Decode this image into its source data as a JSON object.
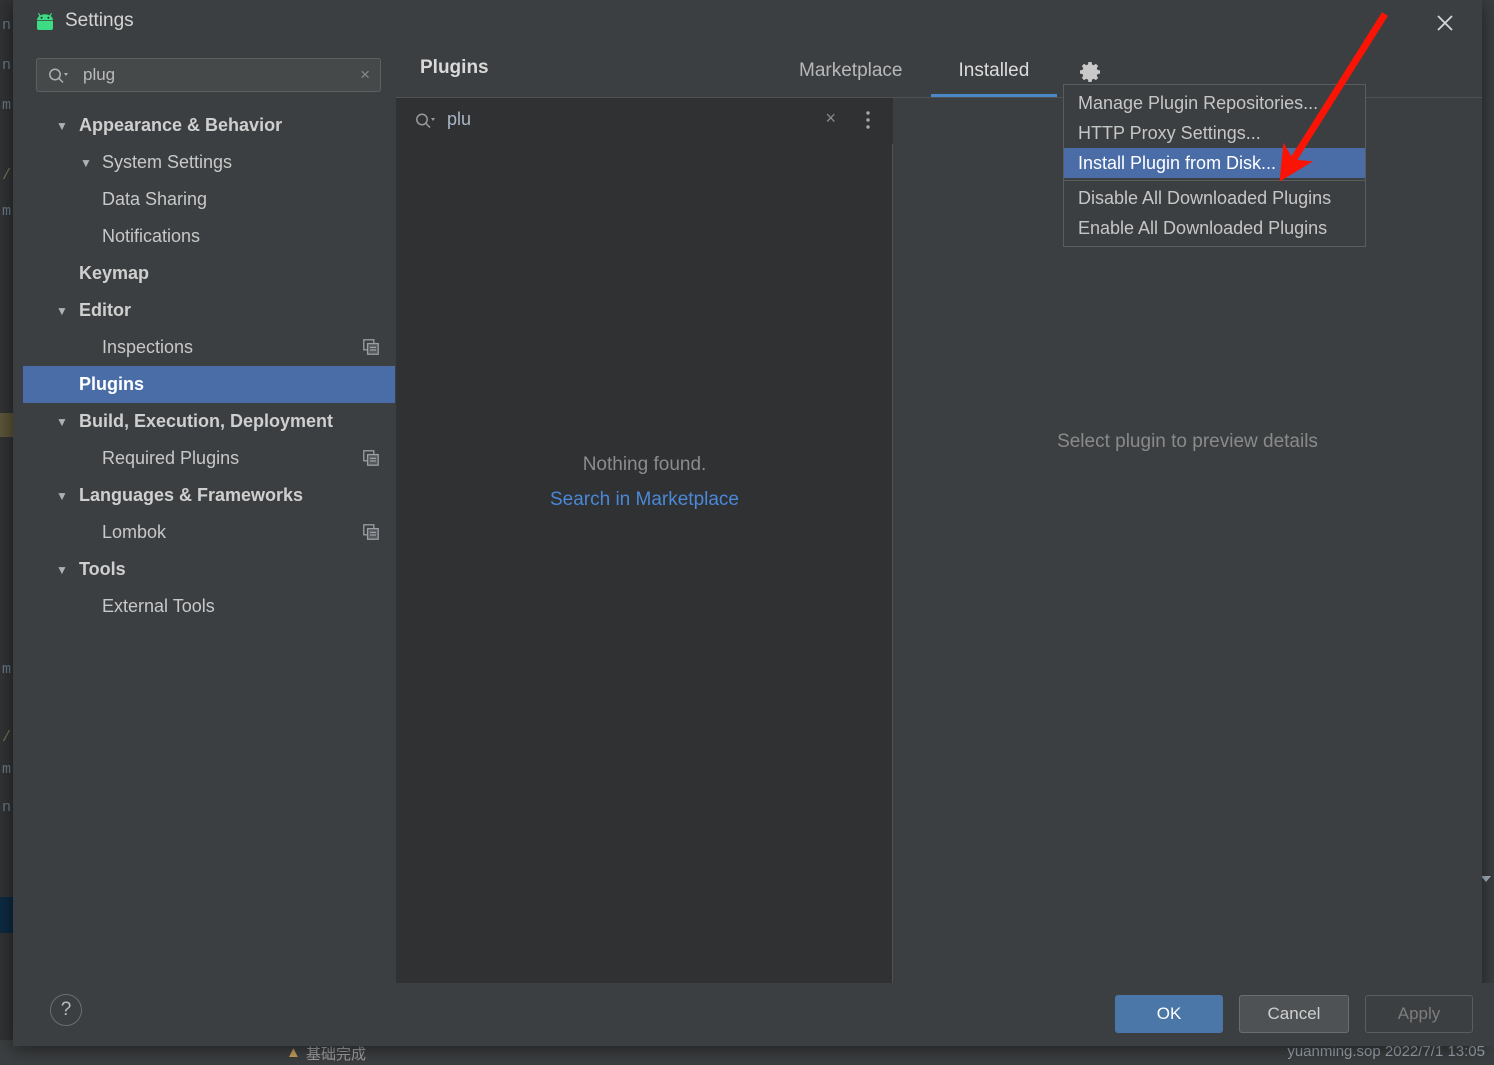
{
  "window": {
    "title": "Settings",
    "icon": "android-icon",
    "close_label": "×"
  },
  "sidebar": {
    "search": {
      "value": "plug",
      "clear_label": "×",
      "icon": "search-icon"
    },
    "items": [
      {
        "label": "Appearance & Behavior",
        "level": 0,
        "group": true,
        "arrow": "▼",
        "selected": false,
        "copy_icon": false
      },
      {
        "label": "System Settings",
        "level": 1,
        "group": false,
        "arrow": "▼",
        "selected": false,
        "copy_icon": false
      },
      {
        "label": "Data Sharing",
        "level": 2,
        "group": false,
        "arrow": "",
        "selected": false,
        "copy_icon": false
      },
      {
        "label": "Notifications",
        "level": 1,
        "group": false,
        "arrow": "",
        "selected": false,
        "copy_icon": false
      },
      {
        "label": "Keymap",
        "level": 0,
        "group": true,
        "arrow": "",
        "selected": false,
        "copy_icon": false
      },
      {
        "label": "Editor",
        "level": 0,
        "group": true,
        "arrow": "▼",
        "selected": false,
        "copy_icon": false
      },
      {
        "label": "Inspections",
        "level": 1,
        "group": false,
        "arrow": "",
        "selected": false,
        "copy_icon": true
      },
      {
        "label": "Plugins",
        "level": 0,
        "group": true,
        "arrow": "",
        "selected": true,
        "copy_icon": false
      },
      {
        "label": "Build, Execution, Deployment",
        "level": 0,
        "group": true,
        "arrow": "▼",
        "selected": false,
        "copy_icon": false
      },
      {
        "label": "Required Plugins",
        "level": 1,
        "group": false,
        "arrow": "",
        "selected": false,
        "copy_icon": true
      },
      {
        "label": "Languages & Frameworks",
        "level": 0,
        "group": true,
        "arrow": "▼",
        "selected": false,
        "copy_icon": false
      },
      {
        "label": "Lombok",
        "level": 1,
        "group": false,
        "arrow": "",
        "selected": false,
        "copy_icon": true
      },
      {
        "label": "Tools",
        "level": 0,
        "group": true,
        "arrow": "▼",
        "selected": false,
        "copy_icon": false
      },
      {
        "label": "External Tools",
        "level": 1,
        "group": false,
        "arrow": "",
        "selected": false,
        "copy_icon": false
      }
    ]
  },
  "main": {
    "title": "Plugins",
    "tabs": [
      {
        "label": "Marketplace",
        "active": false
      },
      {
        "label": "Installed",
        "active": true
      }
    ],
    "gear_icon": "gear-icon",
    "plugin_search": {
      "value": "plu",
      "icon": "search-icon",
      "clear_label": "×",
      "options_icon": "kebab-menu-icon"
    },
    "list_empty_text": "Nothing found.",
    "list_empty_link": "Search in Marketplace",
    "detail_placeholder": "Select plugin to preview details"
  },
  "menu": {
    "items": [
      {
        "label": "Manage Plugin Repositories...",
        "highlight": false,
        "separator_after": false
      },
      {
        "label": "HTTP Proxy Settings...",
        "highlight": false,
        "separator_after": false
      },
      {
        "label": "Install Plugin from Disk...",
        "highlight": true,
        "separator_after": true
      },
      {
        "label": "Disable All Downloaded Plugins",
        "highlight": false,
        "separator_after": false
      },
      {
        "label": "Enable All Downloaded Plugins",
        "highlight": false,
        "separator_after": false
      }
    ]
  },
  "footer": {
    "help_label": "?",
    "ok_label": "OK",
    "cancel_label": "Cancel",
    "apply_label": "Apply"
  },
  "background": {
    "gutter_lines": [
      "n",
      "n",
      "m",
      "/",
      "m",
      "m",
      "/",
      "m",
      "n"
    ],
    "status_left": "基础完成",
    "status_right": "yuanming.sop    2022/7/1 13:05"
  },
  "colors": {
    "selection_blue": "#4a6da7",
    "tab_accent": "#4a88c7",
    "link_blue": "#4a88d8",
    "ok_button": "#4a76a8",
    "panel_bg": "#3c3f41",
    "list_bg": "#2f3133",
    "annotation_red": "#fa1405",
    "android_green": "#3ddc84"
  }
}
